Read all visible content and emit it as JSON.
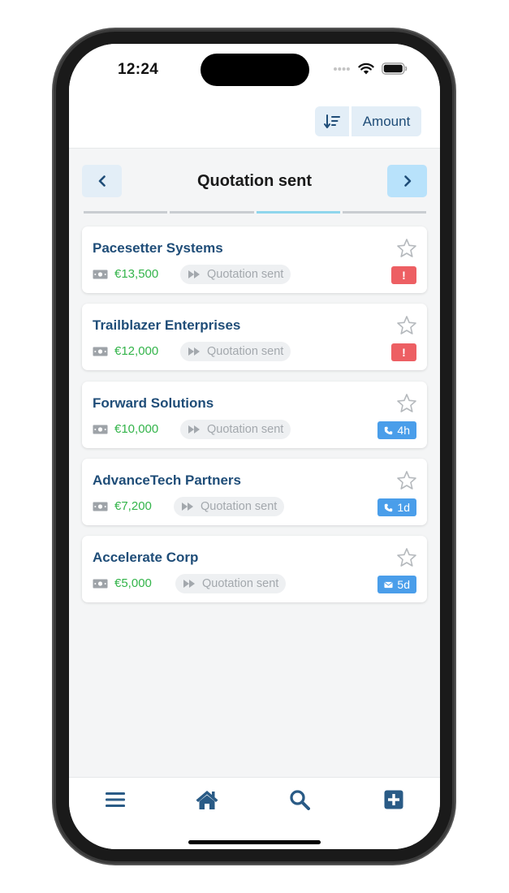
{
  "status_bar": {
    "time": "12:24"
  },
  "toolbar": {
    "sort_icon": "sort-descending-icon",
    "sort_field_label": "Amount"
  },
  "stage_nav": {
    "title": "Quotation sent",
    "prev_icon": "chevron-left-icon",
    "next_icon": "chevron-right-icon",
    "steps_total": 4,
    "active_step": 3
  },
  "deals": [
    {
      "name": "Pacesetter Systems",
      "amount": "€13,500",
      "stage": "Quotation sent",
      "badge": {
        "type": "alert",
        "text": "!"
      }
    },
    {
      "name": "Trailblazer Enterprises",
      "amount": "€12,000",
      "stage": "Quotation sent",
      "badge": {
        "type": "alert",
        "text": "!"
      }
    },
    {
      "name": "Forward Solutions",
      "amount": "€10,000",
      "stage": "Quotation sent",
      "badge": {
        "type": "phone",
        "text": "4h"
      }
    },
    {
      "name": "AdvanceTech Partners",
      "amount": "€7,200",
      "stage": "Quotation sent",
      "badge": {
        "type": "phone",
        "text": "1d"
      }
    },
    {
      "name": "Accelerate Corp",
      "amount": "€5,000",
      "stage": "Quotation sent",
      "badge": {
        "type": "mail",
        "text": "5d"
      }
    }
  ],
  "tab_bar": {
    "items": [
      "menu-icon",
      "home-icon",
      "search-icon",
      "add-icon"
    ]
  },
  "colors": {
    "brand": "#1f4d78",
    "amount": "#33b44a",
    "alert": "#ed5f63",
    "info": "#4a9eea",
    "active_step": "#8fd6ec"
  }
}
